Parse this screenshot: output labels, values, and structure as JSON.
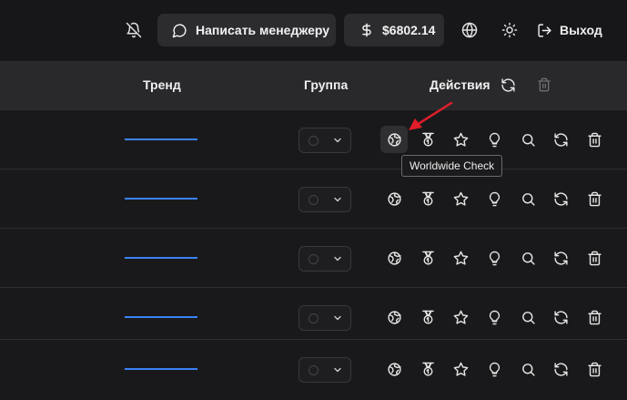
{
  "header": {
    "chat_label": "Написать менеджеру",
    "balance": "$6802.14",
    "logout_label": "Выход"
  },
  "table": {
    "columns": {
      "trend": "Тренд",
      "group": "Группа",
      "actions": "Действия"
    },
    "row_count": 5,
    "trend_color": "#3b82f6"
  },
  "tooltip": {
    "text": "Worldwide Check"
  },
  "annotation": {
    "arrow_color": "#e11d2a"
  }
}
